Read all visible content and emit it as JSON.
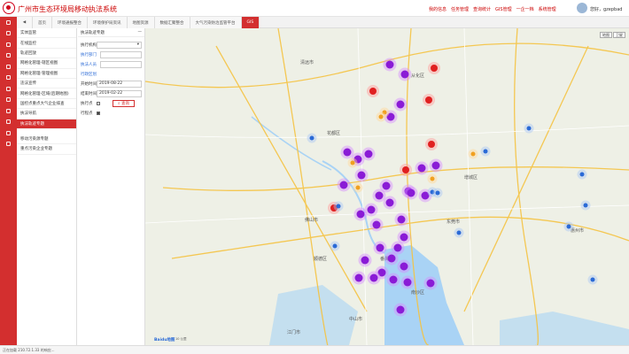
{
  "header": {
    "title": "广州市生态环境局移动执法系统",
    "links": [
      "我的信息",
      "任务管理",
      "查询统计",
      "GIS管理",
      "一企一档",
      "系统管理"
    ],
    "user": "您好，gzepbad"
  },
  "tabs": [
    "首页",
    "环境通报整合",
    "环境保护局资讯",
    "地图资源",
    "数据汇聚整合",
    "大气污染防治监管平台",
    "GIS"
  ],
  "active_tab_index": 6,
  "menu": {
    "items": [
      "实体监管",
      "在线监控",
      "轨迹回放",
      "网格化管理-辖区视图",
      "网格化管理-管理视图",
      "违法宣传",
      "网格化管理-区域(后期地图)",
      "国控点重点大气企业排查",
      "执法导航",
      "执法轨迹专题",
      "移动污染源专题",
      "重点污染企业专题"
    ],
    "active_index": 9
  },
  "panel": {
    "title": "执法轨迹专题",
    "executor_label": "执行机构",
    "executor_value": "",
    "links": [
      "执行部门",
      "执法人员",
      "行政区划"
    ],
    "start_label": "开始时间",
    "start_value": "2019-08-22",
    "end_label": "结束时间",
    "end_value": "2019-02-22",
    "check1_label": "执行点",
    "check2_label": "行程点",
    "search_label": "查询"
  },
  "map": {
    "controls": [
      "地图",
      "卫星"
    ],
    "logo": "Baidu地图",
    "scale": "10 公里",
    "land_color": "#eef0e6",
    "water_color": "#a9d3f5",
    "road_color": "#f5c342",
    "cities": [
      "清远市",
      "花都区",
      "从化区",
      "增城区",
      "佛山市",
      "东莞市",
      "顺德区",
      "番禺区",
      "中山市",
      "南沙区",
      "江门市",
      "惠州市"
    ]
  },
  "status": "正在加载 210.72.1.33 的响应..."
}
